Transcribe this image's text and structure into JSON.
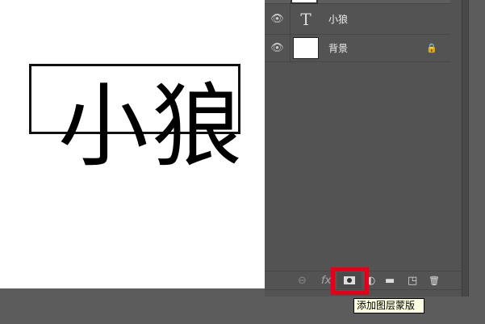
{
  "canvas": {
    "text": "小狼"
  },
  "layers": [
    {
      "type": "text",
      "glyph": "T",
      "name": "小狼",
      "visible": true
    },
    {
      "type": "image",
      "name": "背景",
      "visible": true,
      "locked": true
    }
  ],
  "toolbar": {
    "link": "⊖",
    "fx": "fx",
    "adjust": "◐",
    "folder": "▬",
    "new": "◳",
    "trash": "🗑"
  },
  "tooltip": "添加图层蒙版",
  "highlight_color": "#e0001a"
}
